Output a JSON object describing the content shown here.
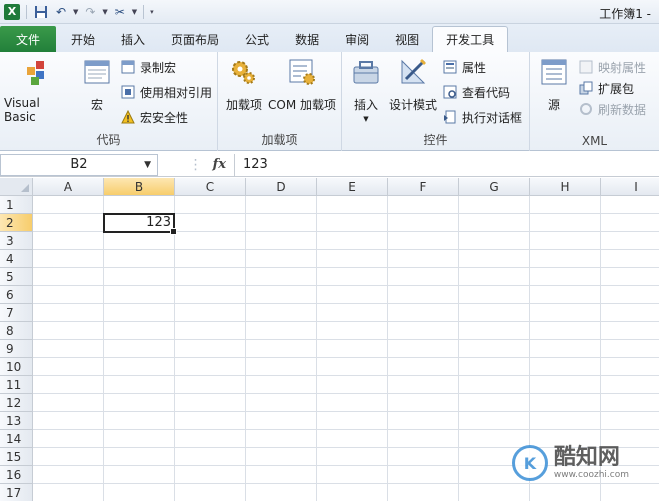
{
  "window": {
    "title": "工作簿1 -"
  },
  "tabs": {
    "file": "文件",
    "items": [
      "开始",
      "插入",
      "页面布局",
      "公式",
      "数据",
      "审阅",
      "视图",
      "开发工具"
    ],
    "active": "开发工具"
  },
  "ribbon": {
    "code": {
      "label": "代码",
      "visual_basic": "Visual Basic",
      "macros": "宏",
      "record_macro": "录制宏",
      "relative_ref": "使用相对引用",
      "macro_security": "宏安全性"
    },
    "addins": {
      "label": "加载项",
      "addins": "加载项",
      "com_addins": "COM 加载项"
    },
    "controls": {
      "label": "控件",
      "insert": "插入",
      "design_mode": "设计模式",
      "properties": "属性",
      "view_code": "查看代码",
      "run_dialog": "执行对话框"
    },
    "xml": {
      "label": "XML",
      "source": "源",
      "map_properties": "映射属性",
      "expansion_packs": "扩展包",
      "refresh_data": "刷新数据"
    }
  },
  "formula_bar": {
    "name_box": "B2",
    "fx": "fx",
    "content": "123"
  },
  "sheet": {
    "columns": [
      "A",
      "B",
      "C",
      "D",
      "E",
      "F",
      "G",
      "H",
      "I"
    ],
    "rows": [
      "1",
      "2",
      "3",
      "4",
      "5",
      "6",
      "7",
      "8",
      "9",
      "10",
      "11",
      "12",
      "13",
      "14",
      "15",
      "16",
      "17"
    ],
    "selected_cell": "B2",
    "selected_value": "123"
  },
  "watermark": {
    "brand": "酷知网",
    "url": "www.coozhi.com"
  },
  "colors": {
    "file_tab": "#22803a",
    "selection_header": "#f7cd6c",
    "ribbon_bg": "#fbfcfe"
  }
}
